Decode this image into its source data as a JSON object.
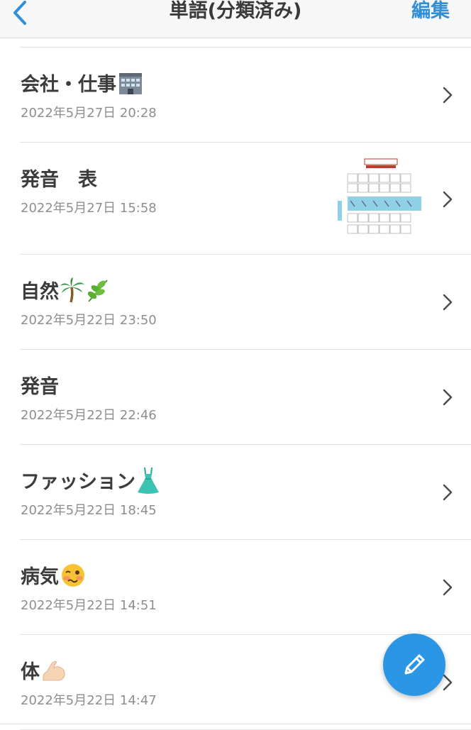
{
  "navbar": {
    "title": "単語(分類済み)",
    "edit_label": "編集",
    "back_icon": "chevron-left-icon",
    "accent_color": "#2f8fd8"
  },
  "rows": [
    {
      "title": "会社・仕事",
      "emoji": "office-building-emoji",
      "date": "2022年5月27日 20:28"
    },
    {
      "title": "発音　表",
      "thumbnail": "phonetic-chart-image",
      "date": "2022年5月27日 15:58"
    },
    {
      "title": "自然",
      "emoji": "palm-tree-and-herb-emoji",
      "date": "2022年5月22日 23:50"
    },
    {
      "title": "発音",
      "date": "2022年5月22日 22:46"
    },
    {
      "title": "ファッション",
      "emoji": "dress-emoji",
      "date": "2022年5月22日 18:45"
    },
    {
      "title": "病気",
      "emoji": "woozy-face-emoji",
      "date": "2022年5月22日 14:51"
    },
    {
      "title": "体",
      "emoji": "flexed-biceps-emoji",
      "date": "2022年5月22日 14:47"
    }
  ],
  "fab": {
    "icon": "pencil-icon",
    "color": "#2b95e6"
  }
}
